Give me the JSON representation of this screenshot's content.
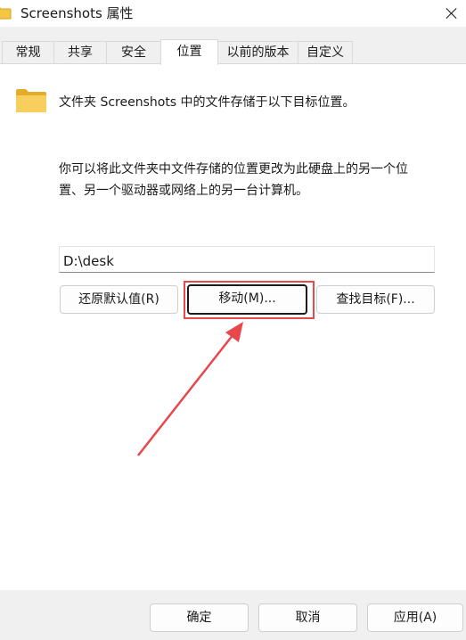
{
  "window": {
    "title": "Screenshots 属性"
  },
  "tabs": [
    {
      "label": "常规"
    },
    {
      "label": "共享"
    },
    {
      "label": "安全"
    },
    {
      "label": "位置",
      "active": true
    },
    {
      "label": "以前的版本"
    },
    {
      "label": "自定义"
    }
  ],
  "location": {
    "header": "文件夹 Screenshots 中的文件存储于以下目标位置。",
    "description_line1": "你可以将此文件夹中文件存储的位置更改为此硬盘上的另一个位",
    "description_line2": "置、另一个驱动器或网络上的另一台计算机。",
    "path_value": "D:\\desk",
    "restore_default_label": "还原默认值(R)",
    "move_label": "移动(M)...",
    "find_target_label": "查找目标(F)..."
  },
  "footer": {
    "ok_label": "确定",
    "cancel_label": "取消",
    "apply_label": "应用(A)"
  },
  "colors": {
    "highlight": "#e8474b",
    "folder": "#f5c544"
  },
  "icons": {
    "title": "folder-icon",
    "header": "folder-icon",
    "close": "close-icon"
  }
}
